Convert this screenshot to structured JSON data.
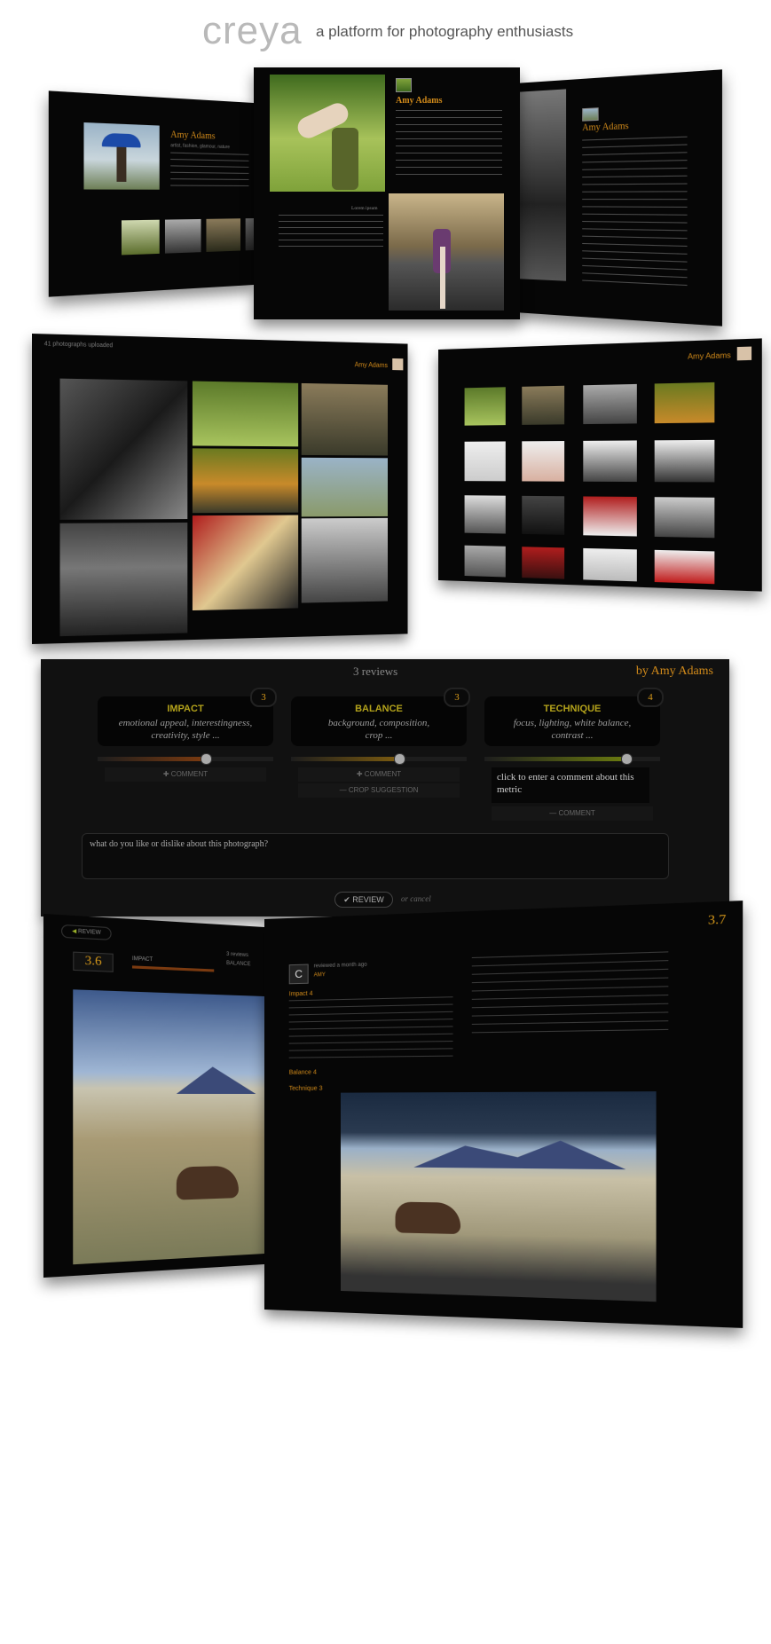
{
  "brand": {
    "logo": "creya",
    "tagline": "a platform for photography enthusiasts"
  },
  "profile_panels": {
    "left": {
      "name": "Amy Adams",
      "subtitle": "artist, fashion, glamour, nature"
    },
    "center": {
      "name": "Amy Adams",
      "caption": "Lorem ipsum"
    },
    "right": {
      "name": "Amy Adams"
    }
  },
  "gallery": {
    "left": {
      "count_text": "41 photographs uploaded",
      "owner": "Amy Adams"
    },
    "right": {
      "owner": "Amy Adams"
    }
  },
  "review": {
    "title": "3 reviews",
    "by": "by Amy Adams",
    "metrics": [
      {
        "name": "IMPACT",
        "desc1": "emotional appeal, interestingness,",
        "desc2": "creativity, style ...",
        "score": "3",
        "level": 0.6,
        "accent": "#7a3a10"
      },
      {
        "name": "BALANCE",
        "desc1": "background, composition,",
        "desc2": "crop ...",
        "score": "3",
        "level": 0.6,
        "accent": "#7a5a10"
      },
      {
        "name": "TECHNIQUE",
        "desc1": "focus, lighting, white balance,",
        "desc2": "contrast ...",
        "score": "4",
        "level": 0.8,
        "accent": "#6a7a10"
      }
    ],
    "comment_label": "COMMENT",
    "crop_label": "CROP SUGGESTION",
    "comment_prompt": "click to enter a comment about this metric",
    "review_placeholder": "what do you like or dislike about this photograph?",
    "review_button": "REVIEW",
    "cancel_text": "or cancel"
  },
  "bottom": {
    "left": {
      "back": "REVIEW",
      "score": "3.6",
      "metric_label": "IMPACT",
      "reviews": "3 reviews",
      "balance_label": "BALANCE"
    },
    "right": {
      "score": "3.7",
      "avatar_letter": "C",
      "meta": "reviewed a month ago",
      "author": "AMY",
      "impact_label": "Impact 4",
      "balance_label": "Balance 4",
      "technique_label": "Technique 3"
    }
  }
}
